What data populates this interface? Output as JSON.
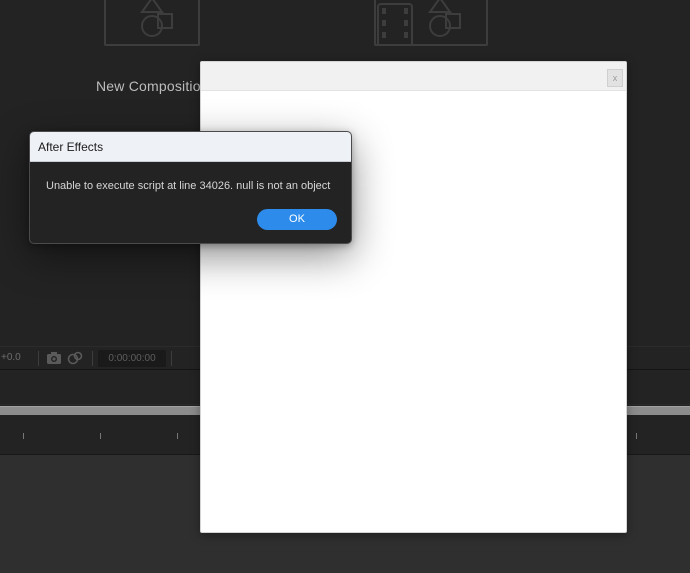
{
  "home": {
    "new_composition_label": "New Compositio"
  },
  "comp_toolbar": {
    "zoom_value": "+0.0",
    "timecode": "0:00:00:00"
  },
  "script_panel": {
    "close_label": "x"
  },
  "alert": {
    "title": "After Effects",
    "message": "Unable to execute script at line 34026. null is not an object",
    "ok_label": "OK"
  },
  "colors": {
    "ok_button": "#2d8ceb",
    "alert_title_bg": "#eef2f7",
    "app_bg": "#232323",
    "scrollbar": "#8c8c8c"
  }
}
